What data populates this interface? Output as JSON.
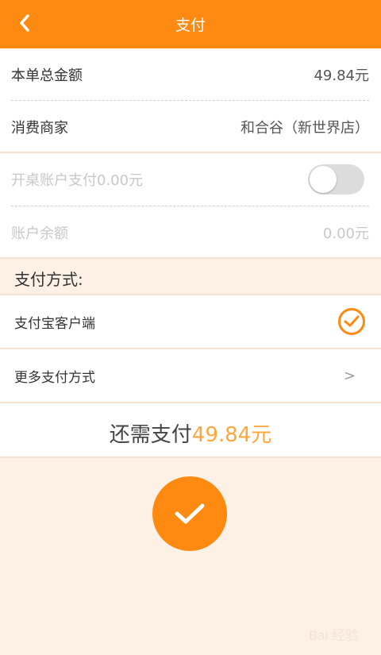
{
  "header": {
    "title": "支付",
    "back_icon": "chevron-left-icon"
  },
  "order": {
    "total_label": "本单总金额",
    "total_value": "49.84元",
    "merchant_label": "消费商家",
    "merchant_value": "和合谷（新世界店）"
  },
  "account": {
    "table_pay_label": "开桌账户支付0.00元",
    "toggle_on": false,
    "balance_label": "账户余额",
    "balance_value": "0.00元"
  },
  "payment": {
    "section_title": "支付方式:",
    "methods": [
      {
        "label": "支付宝客户端",
        "selected": true
      },
      {
        "label": "更多支付方式",
        "chevron": ">"
      }
    ]
  },
  "summary": {
    "prefix": "还需支付",
    "amount": "49.84元"
  },
  "colors": {
    "accent": "#ff8a12",
    "amount": "#ffa63d",
    "background": "#fdf1e6"
  },
  "watermark": {
    "text": "Bai 经验"
  }
}
